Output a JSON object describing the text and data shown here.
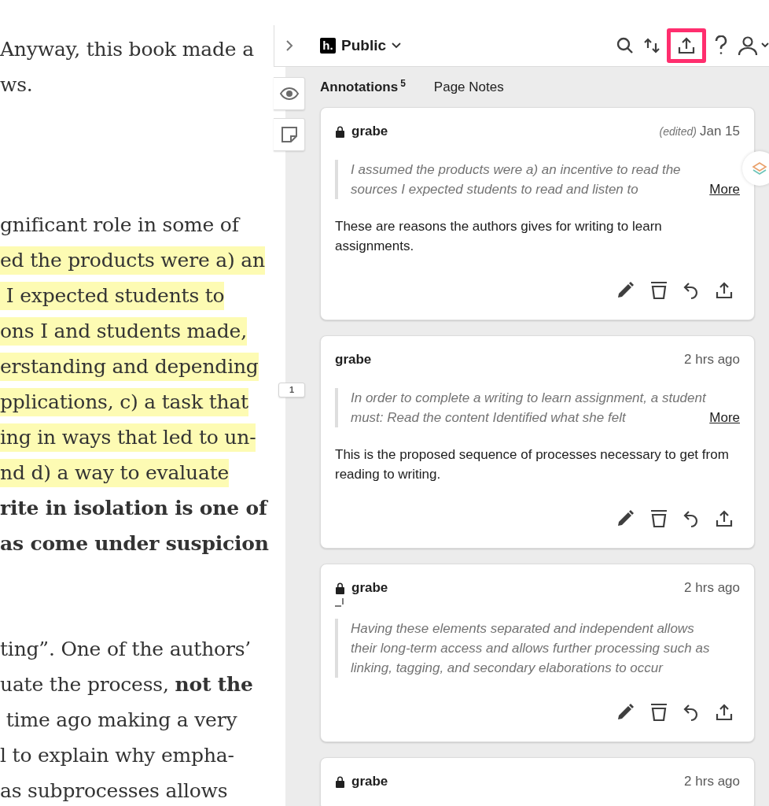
{
  "article": {
    "paragraphs": [
      {
        "lines": [
          {
            "text": "Anyway, this book made a",
            "kind": "plain"
          },
          {
            "text": "ws.",
            "kind": "plain"
          }
        ]
      },
      {
        "lines": [
          {
            "text": "gnificant role in some of",
            "kind": "plain"
          },
          {
            "text": "ed the products were a) an",
            "kind": "highlight"
          },
          {
            "text": " I expected students to",
            "kind": "highlight"
          },
          {
            "text": "ons I and students made,",
            "kind": "highlight"
          },
          {
            "text": "erstanding and depending",
            "kind": "highlight"
          },
          {
            "text": "pplications, c) a task that",
            "kind": "highlight"
          },
          {
            "text": "ing in ways that led to un-",
            "kind": "highlight"
          },
          {
            "text": "nd d) a way to evaluate",
            "kind": "highlight"
          },
          {
            "text": "rite in isolation is one of",
            "kind": "bold"
          },
          {
            "text": "as come under suspicion",
            "kind": "bold"
          }
        ]
      },
      {
        "lines": [
          {
            "text": "ting”. One of the authors’",
            "kind": "plain"
          },
          {
            "text": "uate the process, **not the**",
            "kind": "plain"
          },
          {
            "text": " time ago making a very",
            "kind": "plain"
          },
          {
            "text": "l to explain why empha-",
            "kind": "plain"
          },
          {
            "text": "as subprocesses allows",
            "kind": "plain"
          }
        ]
      }
    ]
  },
  "sidebar": {
    "top_bar": {
      "logo": "h.",
      "group": "Public",
      "tools": [
        {
          "kind": "search",
          "highlighted": false
        },
        {
          "kind": "sort",
          "highlighted": false
        },
        {
          "kind": "share",
          "highlighted": true
        },
        {
          "kind": "help",
          "highlighted": false
        },
        {
          "kind": "user",
          "highlighted": false
        }
      ]
    },
    "side_tools": [
      {
        "kind": "eye"
      },
      {
        "kind": "note"
      }
    ],
    "bucket": "1",
    "tabs": [
      {
        "label": "Annotations",
        "count": "5",
        "selected": true
      },
      {
        "label": "Page Notes",
        "selected": false
      }
    ],
    "annotations": [
      {
        "locked": true,
        "flagged": false,
        "user": "grabe",
        "edited": "(edited)",
        "time": "Jan 15",
        "quote": "I assumed the products were a) an incentive to read the sources I expected students to read and listen to",
        "more": "More",
        "body": "These are reasons the authors gives for writing to learn assignments."
      },
      {
        "locked": false,
        "flagged": false,
        "user": "grabe",
        "time": "2 hrs ago",
        "quote": "In order to complete a writing to learn assignment, a student must: Read the content Identified what she felt",
        "more": "More",
        "body": "This is the proposed sequence of processes necessary to get from reading to writing."
      },
      {
        "locked": true,
        "flagged": true,
        "user": "grabe",
        "time": "2 hrs ago",
        "quote": "Having these elements separated and independent allows their long-term access and allows further processing such as linking, tagging, and secondary elaborations to occur"
      },
      {
        "locked": true,
        "flagged": false,
        "user": "grabe",
        "time": "2 hrs ago"
      }
    ]
  }
}
